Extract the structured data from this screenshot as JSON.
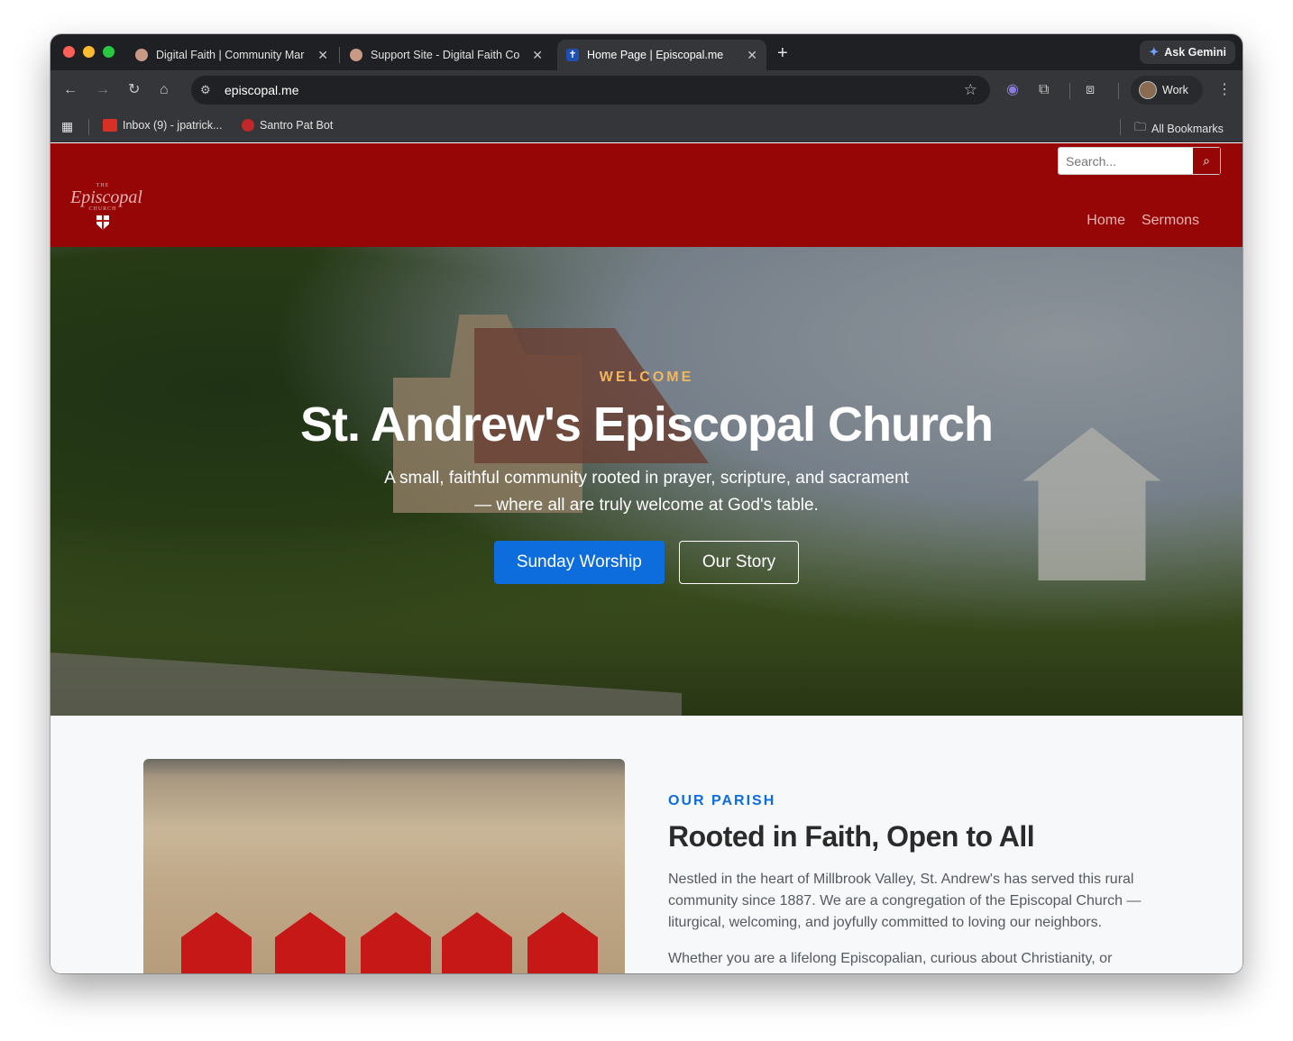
{
  "browser": {
    "tabs": [
      {
        "title": "Digital Faith | Community Mar",
        "active": false,
        "favicon_color": "#c89a86"
      },
      {
        "title": "Support Site - Digital Faith Co",
        "active": false,
        "favicon_color": "#c89a86"
      },
      {
        "title": "Home Page | Episcopal.me",
        "active": true,
        "favicon_color": "#1f4fb0"
      }
    ],
    "new_tab_label": "+",
    "close_label": "✕",
    "ask_gemini": "Ask Gemini",
    "url": "episcopal.me",
    "profile": "Work",
    "bookmarks": [
      {
        "label": "Inbox (9) - jpatrick...",
        "icon": "gmail-icon"
      },
      {
        "label": "Santro Pat Bot",
        "icon": "bot-icon"
      }
    ],
    "all_bookmarks": "All Bookmarks"
  },
  "site": {
    "logo": {
      "the": "THE",
      "name": "Episcopal",
      "church": "CHURCH"
    },
    "search_placeholder": "Search...",
    "nav": [
      "Home",
      "Sermons"
    ],
    "hero": {
      "eyebrow": "WELCOME",
      "title": "St. Andrew's Episcopal Church",
      "lead_line1": "A small, faithful community rooted in prayer, scripture, and sacrament",
      "lead_line2": "— where all are truly welcome at God's table.",
      "primary_button": "Sunday Worship",
      "secondary_button": "Our Story"
    },
    "parish": {
      "eyebrow": "OUR PARISH",
      "title": "Rooted in Faith, Open to All",
      "paragraph1": "Nestled in the heart of Millbrook Valley, St. Andrew's has served this rural community since 1887. We are a congregation of the Episcopal Church — liturgical, welcoming, and joyfully committed to loving our neighbors.",
      "paragraph2": "Whether you are a lifelong Episcopalian, curious about Christianity, or"
    }
  },
  "colors": {
    "header": "#960606",
    "primary": "#0d6ddd",
    "accent": "#f1b65e"
  }
}
